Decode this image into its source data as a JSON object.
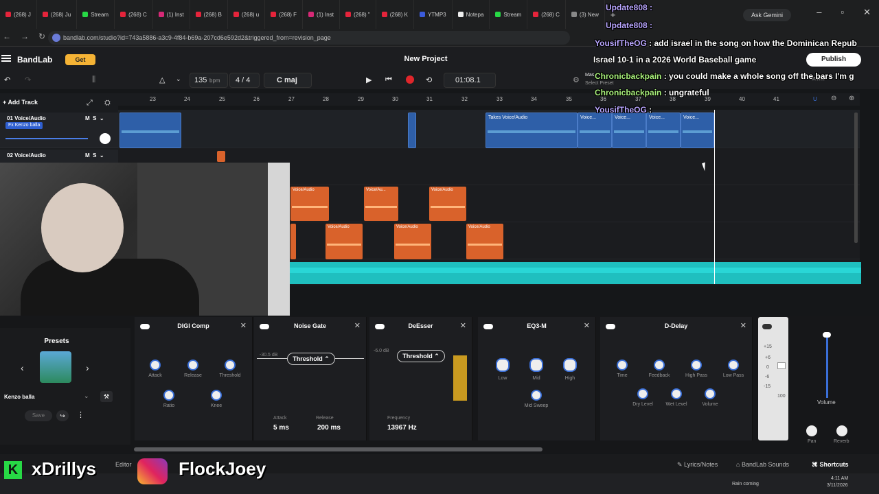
{
  "browser": {
    "tabs": [
      "(268) J",
      "(268) Ju",
      "Stream",
      "(268) C",
      "(1) Inst",
      "(268) B",
      "(268) u",
      "(268) F",
      "(1) Inst",
      "(268) \"",
      "(268) K",
      "YTMP3",
      "Notepa",
      "Stream",
      "(268) C",
      "(3) New"
    ],
    "url": "bandlab.com/studio?id=743a5886-a3c9-4f84-b69a-207cd6e592d2&triggered_from=revision_page",
    "ask_gemini": "Ask Gemini"
  },
  "app": {
    "logo": "BandLab",
    "get": "Get",
    "project": "New Project",
    "publish": "Publish",
    "bpm": "135",
    "bpm_unit": "bpm",
    "time_sig": "4 / 4",
    "key": "C maj",
    "time": "01:08.1",
    "master_label": "Mas",
    "select_preset": "Select Preset",
    "invite": "Invite"
  },
  "ruler": [
    "23",
    "24",
    "25",
    "26",
    "27",
    "28",
    "29",
    "30",
    "31",
    "32",
    "33",
    "34",
    "35",
    "36",
    "37",
    "38",
    "39",
    "40",
    "41"
  ],
  "tracks": {
    "add": "Add Track",
    "t1": {
      "name": "01 Voice/Audio",
      "fx": "Fx Kenzo balla",
      "m": "M",
      "s": "S"
    },
    "t2": {
      "name": "02 Voice/Audio",
      "m": "M",
      "s": "S"
    }
  },
  "clips": {
    "voice": "Voice/Audio",
    "voice_short": "Voice/Au...",
    "takes": "Takes",
    "voice_t": "Voice..."
  },
  "presets": {
    "title": "Presets",
    "name": "Kenzo balla",
    "save": "Save"
  },
  "fx": {
    "digicomp": {
      "title": "DIGI Comp",
      "knobs": [
        "Attack",
        "Release",
        "Threshold",
        "Ratio",
        "Knee"
      ]
    },
    "gate": {
      "title": "Noise Gate",
      "db": "-30.5 dB",
      "pill": "Threshold",
      "attack": "Attack",
      "attack_v": "5 ms",
      "release": "Release",
      "release_v": "200 ms"
    },
    "deesser": {
      "title": "DeEsser",
      "db": "-6.0 dB",
      "pill": "Threshold",
      "freq": "Frequency",
      "freq_v": "13967 Hz"
    },
    "eq": {
      "title": "EQ3-M",
      "knobs": [
        "Low",
        "Mid",
        "High",
        "Mid Sweep"
      ]
    },
    "delay": {
      "title": "D-Delay",
      "knobs": [
        "Time",
        "Feedback",
        "High Pass",
        "Low Pass",
        "Dry Level",
        "Wet Level",
        "Volume"
      ]
    },
    "master_scale": [
      "+15",
      "+6",
      "0",
      "-6",
      "-15",
      "100"
    ],
    "volume": "Volume",
    "pan": "Pan",
    "reverb": "Reverb"
  },
  "bottom": {
    "lyrics": "Lyrics/Notes",
    "sounds": "BandLab Sounds",
    "shortcuts": "Shortcuts",
    "editor": "Editor"
  },
  "overlay": {
    "k": "K",
    "name1": "xDrillys",
    "name2": "FlockJoey"
  },
  "taskbar": {
    "weather": "Rain coming",
    "time": "4:11 AM",
    "date": "3/11/2026"
  },
  "chat": [
    {
      "user": "Update808 :",
      "msg": ""
    },
    {
      "user": "Update808 :",
      "msg": ""
    },
    {
      "user": "YousifTheOG",
      "msg": ": add israel in the song on how the Dominican Repub"
    },
    {
      "user": "",
      "msg": "Israel 10-1 in a 2026 World Baseball",
      "extra": "game"
    },
    {
      "user": "Chronicbackpain",
      "msg": ": you could make a whole song off the bars I'm g"
    },
    {
      "user": "Chronicbackpain",
      "msg": ": ungrateful"
    },
    {
      "user": "YousifTheOG",
      "msg": ":"
    }
  ],
  "colors": {
    "accent": "#3a6fd8",
    "clip_blue": "#2e5fa8",
    "clip_orange": "#d9622b",
    "teal": "#1fbfbf",
    "record": "#e0262b",
    "get": "#f5b335"
  }
}
